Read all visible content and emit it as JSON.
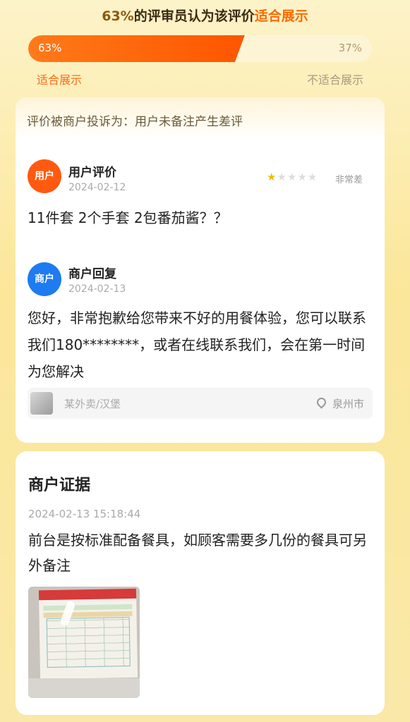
{
  "vote": {
    "header_pct": "63%",
    "header_mid": "的评审员认为该评价",
    "header_hl": "适合展示",
    "left_pct": "63%",
    "right_pct": "37%",
    "left_label": "适合展示",
    "right_label": "不适合展示",
    "left_fraction": 0.63,
    "accent_color": "#ff6a00"
  },
  "review": {
    "complaint": "评价被商户投诉为：用户未备注产生差评",
    "user": {
      "avatar_label": "用户",
      "title": "用户评价",
      "date": "2024-02-12",
      "rating": 1,
      "rating_max": 5,
      "rating_text": "非常差",
      "text": "11件套 2个手套 2包番茄酱？？"
    },
    "merchant": {
      "avatar_label": "商户",
      "title": "商户回复",
      "date": "2024-02-13",
      "text": "您好，非常抱歉给您带来不好的用餐体验，您可以联系我们180********，或者在线联系我们，会在第一时间为您解决"
    },
    "store": {
      "name": "某外卖/汉堡",
      "city": "泉州市",
      "icon": "location-pin-icon"
    }
  },
  "evidence": {
    "title": "商户证据",
    "datetime": "2024-02-13 15:18:44",
    "text": "前台是按标准配备餐具，如顾客需要多几份的餐具可另外备注"
  }
}
